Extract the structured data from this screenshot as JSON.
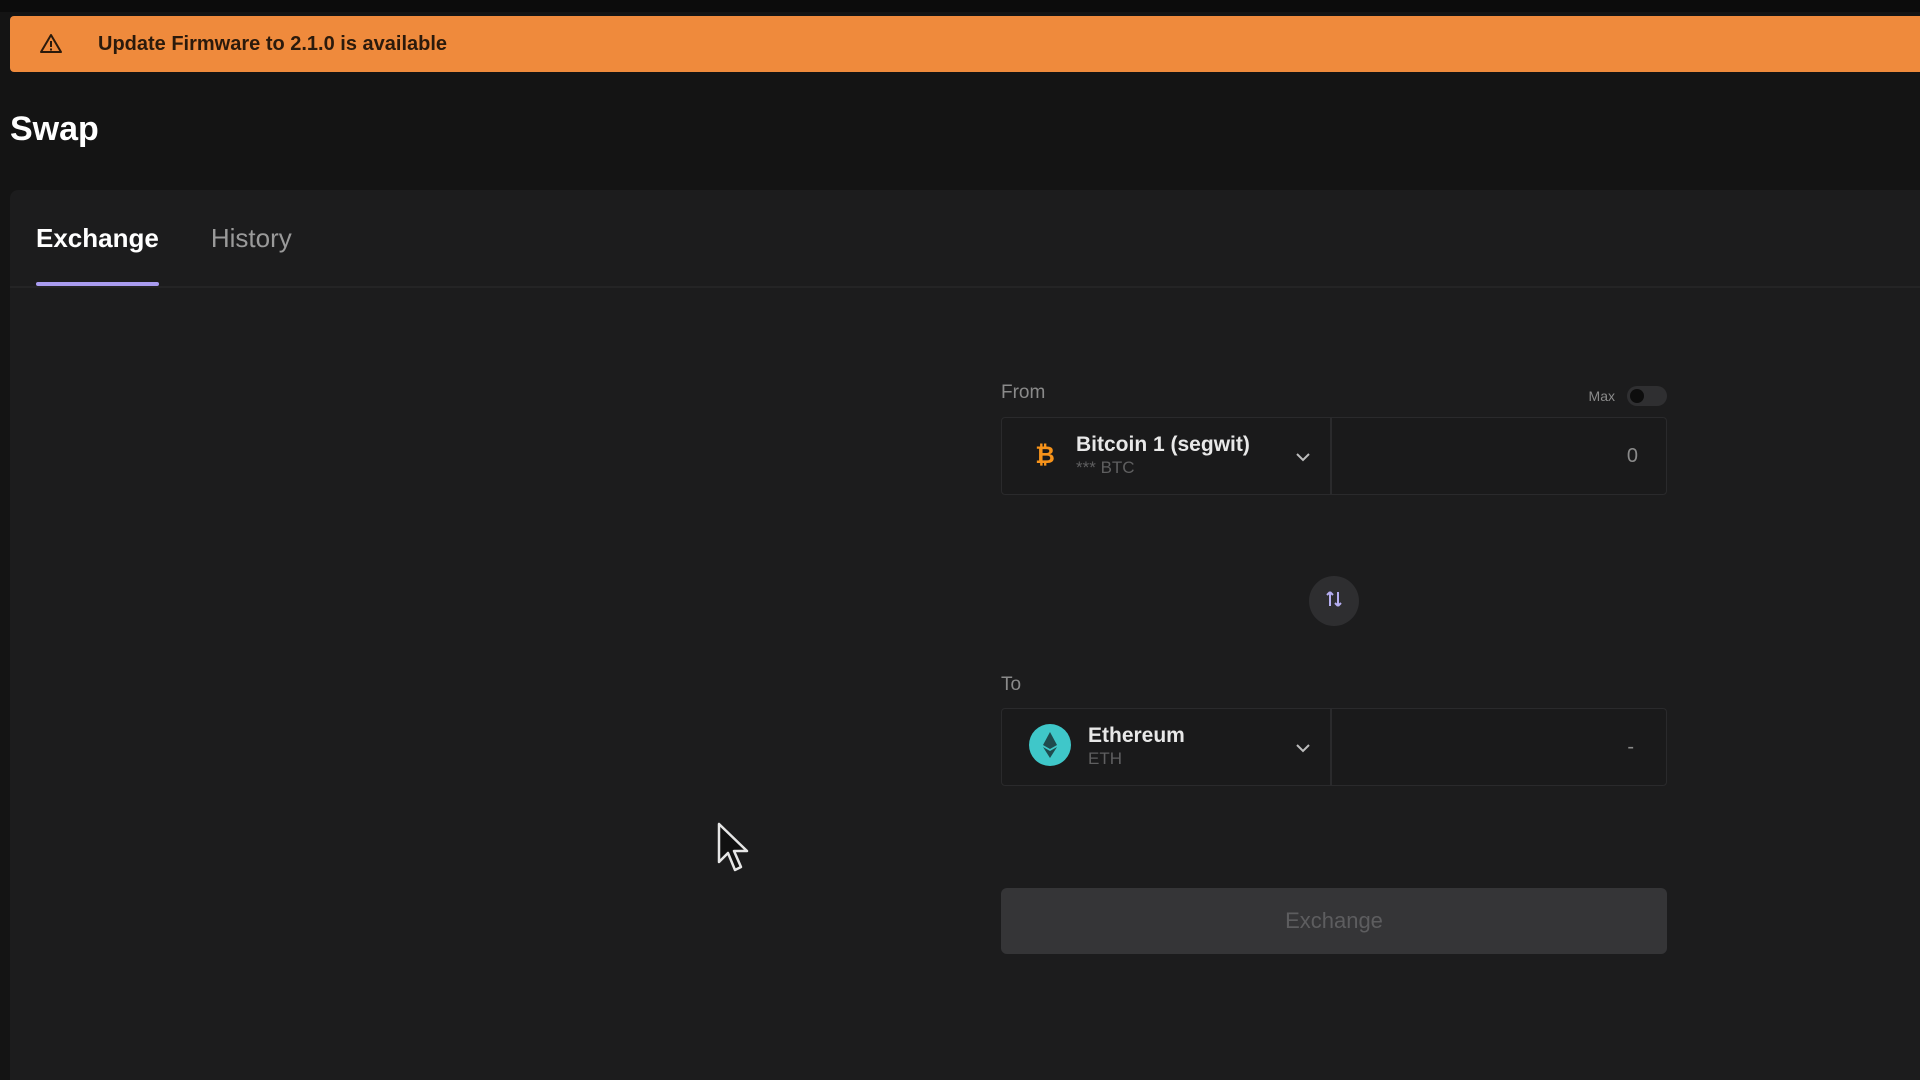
{
  "banner": {
    "text": "Update Firmware to 2.1.0 is available",
    "color": "#ef8a3c"
  },
  "page": {
    "title": "Swap"
  },
  "tabs": [
    {
      "label": "Exchange",
      "active": true
    },
    {
      "label": "History",
      "active": false
    }
  ],
  "swap": {
    "from_label": "From",
    "max_label": "Max",
    "max_enabled": false,
    "from_asset": {
      "name": "Bitcoin 1 (segwit)",
      "sub": "*** BTC",
      "icon": "bitcoin-icon",
      "color": "#f7931a"
    },
    "from_amount": "0",
    "to_label": "To",
    "to_asset": {
      "name": "Ethereum",
      "sub": "ETH",
      "icon": "ethereum-icon",
      "color": "#3fc7c9"
    },
    "to_amount": "-",
    "exchange_label": "Exchange"
  },
  "colors": {
    "accent": "#a99cf0",
    "background": "#141414",
    "panel": "#1c1c1d"
  }
}
